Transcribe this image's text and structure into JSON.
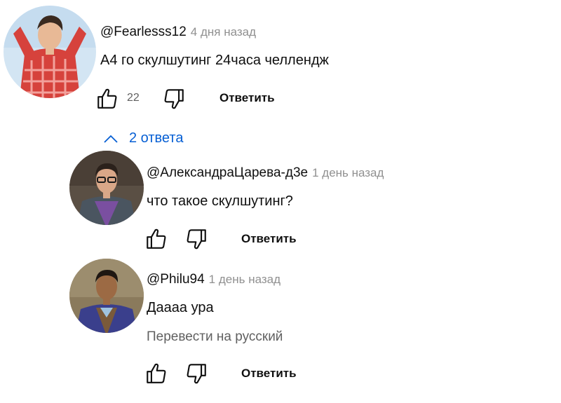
{
  "comment": {
    "author": "@Fearlesss12",
    "time": "4 дня назад",
    "text": "А4 го скулшутинг 24часа челлендж",
    "likes": "22",
    "reply_label": "Ответить",
    "avatar_icon": "avatar-icon"
  },
  "replies_toggle": {
    "label": "2 ответа",
    "icon": "chevron-up-icon"
  },
  "replies": [
    {
      "author": "@АлександраЦарева-д3е",
      "time": "1 день назад",
      "text": "что такое скулшутинг?",
      "reply_label": "Ответить"
    },
    {
      "author": "@Philu94",
      "time": "1 день назад",
      "text": "Даааа ура",
      "translate_label": "Перевести на русский",
      "reply_label": "Ответить"
    }
  ],
  "colors": {
    "link": "#065fd4",
    "secondary": "#606060",
    "meta": "#909090",
    "text": "#0f0f0f"
  }
}
